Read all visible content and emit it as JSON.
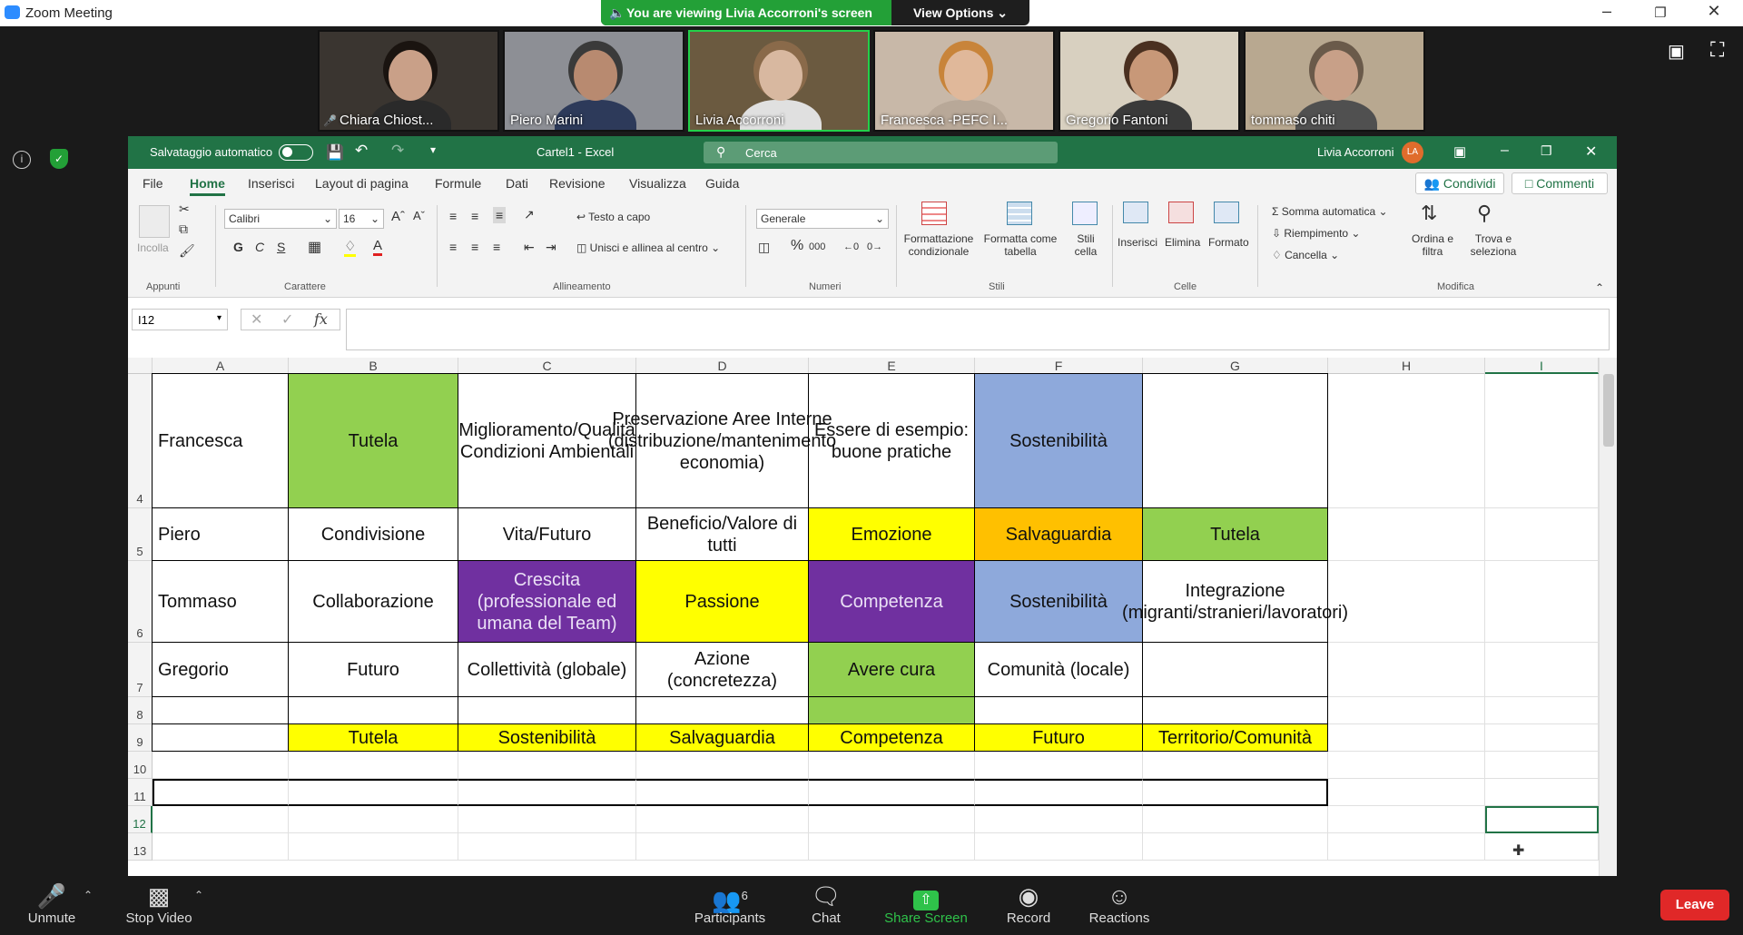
{
  "zoom": {
    "window_title": "Zoom Meeting",
    "banner_text": "You are viewing Livia Accorroni's screen",
    "view_options": "View Options",
    "participants": [
      {
        "name": "Chiara Chiost...",
        "bg": "#3a3530",
        "skin": "#c9a088",
        "hair": "#1a1410",
        "shirt": "#2a2a2a"
      },
      {
        "name": "Piero Marini",
        "bg": "#8d8f95",
        "skin": "#b88a70",
        "hair": "#3a3a3a",
        "shirt": "#2d3a5a"
      },
      {
        "name": "Livia Accorroni",
        "bg": "#6b5a40",
        "skin": "#d8b8a0",
        "hair": "#8a6a4a",
        "shirt": "#e0e0e0"
      },
      {
        "name": "Francesca -PEFC I...",
        "bg": "#c8b8a8",
        "skin": "#e0b89a",
        "hair": "#c8843a",
        "shirt": "#b8a898"
      },
      {
        "name": "Gregorio Fantoni",
        "bg": "#d8d0c0",
        "skin": "#c89878",
        "hair": "#4a3020",
        "shirt": "#3a3a3a"
      },
      {
        "name": "tommaso chiti",
        "bg": "#b8a890",
        "skin": "#c8a088",
        "hair": "#6a5a4a",
        "shirt": "#505050"
      }
    ],
    "bottom": {
      "unmute": "Unmute",
      "stop_video": "Stop Video",
      "participants": "Participants",
      "participants_count": "6",
      "chat": "Chat",
      "share_screen": "Share Screen",
      "record": "Record",
      "reactions": "Reactions",
      "leave": "Leave"
    }
  },
  "excel": {
    "autosave": "Salvataggio automatico",
    "title": "Cartel1 - Excel",
    "search": "Cerca",
    "user": "Livia Accorroni",
    "user_initials": "LA",
    "tabs": [
      "File",
      "Home",
      "Inserisci",
      "Layout di pagina",
      "Formule",
      "Dati",
      "Revisione",
      "Visualizza",
      "Guida"
    ],
    "share": "Condividi",
    "comments": "Commenti",
    "ribbon": {
      "incolla": "Incolla",
      "appunti": "Appunti",
      "font": "Calibri",
      "size": "16",
      "bold": "G",
      "italic": "C",
      "underline": "S",
      "carattere": "Carattere",
      "testo_a_capo": "Testo a capo",
      "unisci": "Unisci e allinea al centro",
      "allineamento": "Allineamento",
      "formato_num": "Generale",
      "numeri": "Numeri",
      "formattazione": "Formattazione condizionale",
      "formatta_tabella": "Formatta come tabella",
      "stili_cella": "Stili cella",
      "stili": "Stili",
      "inserisci": "Inserisci",
      "elimina": "Elimina",
      "formato": "Formato",
      "celle": "Celle",
      "somma": "Somma automatica",
      "riempimento": "Riempimento",
      "cancella": "Cancella",
      "ordina": "Ordina e filtra",
      "trova": "Trova e seleziona",
      "modifica": "Modifica"
    },
    "name_box": "I12",
    "columns": [
      "A",
      "B",
      "C",
      "D",
      "E",
      "F",
      "G",
      "H",
      "I"
    ],
    "rows": [
      {
        "num": "4",
        "cells": [
          "Francesca",
          "Tutela",
          "Miglioramento/Qualità  Condizioni Ambientali",
          "Preservazione Aree Interne (distribuzione/mantenimento economia)",
          "Essere di esempio: buone pratiche",
          "Sostenibilità",
          ""
        ]
      },
      {
        "num": "5",
        "cells": [
          "Piero",
          "Condivisione",
          "Vita/Futuro",
          "Beneficio/Valore di tutti",
          "Emozione",
          "Salvaguardia",
          "Tutela"
        ]
      },
      {
        "num": "6",
        "cells": [
          "Tommaso",
          "Collaborazione",
          "Crescita (professionale ed umana del Team)",
          "Passione",
          "Competenza",
          "Sostenibilità",
          "Integrazione (migranti/stranieri/lavoratori)"
        ]
      },
      {
        "num": "7",
        "cells": [
          "Gregorio",
          "Futuro",
          "Collettività (globale)",
          "Azione (concretezza)",
          "Avere cura",
          "Comunità (locale)",
          ""
        ]
      },
      {
        "num": "8",
        "cells": [
          "",
          "",
          "",
          "",
          "",
          "",
          ""
        ]
      },
      {
        "num": "9",
        "cells": [
          "",
          "Tutela",
          "Sostenibilità",
          "Salvaguardia",
          "Competenza",
          "Futuro",
          "Territorio/Comunità"
        ]
      },
      {
        "num": "10",
        "cells": [
          "",
          "",
          "",
          "",
          "",
          "",
          ""
        ]
      },
      {
        "num": "11",
        "cells": [
          "",
          "",
          "",
          "",
          "",
          "",
          ""
        ]
      },
      {
        "num": "12",
        "cells": [
          "",
          "",
          "",
          "",
          "",
          "",
          ""
        ]
      },
      {
        "num": "13",
        "cells": [
          "",
          "",
          "",
          "",
          "",
          "",
          ""
        ]
      }
    ],
    "colors": {
      "green": "#92d050",
      "blue": "#8ea9db",
      "yellow": "#ffff00",
      "orange": "#ffc000",
      "purple": "#7030a0",
      "excel_green": "#217346"
    },
    "fills": {
      "4": [
        "",
        "green",
        "",
        "",
        "",
        "blue",
        ""
      ],
      "5": [
        "",
        "",
        "",
        "",
        "yellow",
        "orange",
        "green"
      ],
      "6": [
        "",
        "",
        "purple",
        "yellow",
        "purple",
        "blue",
        ""
      ],
      "7": [
        "",
        "",
        "",
        "",
        "green",
        "",
        ""
      ],
      "8": [
        "",
        "",
        "",
        "",
        "green",
        "",
        ""
      ],
      "9": [
        "",
        "yellow",
        "yellow",
        "yellow",
        "yellow",
        "yellow",
        "yellow"
      ]
    }
  }
}
